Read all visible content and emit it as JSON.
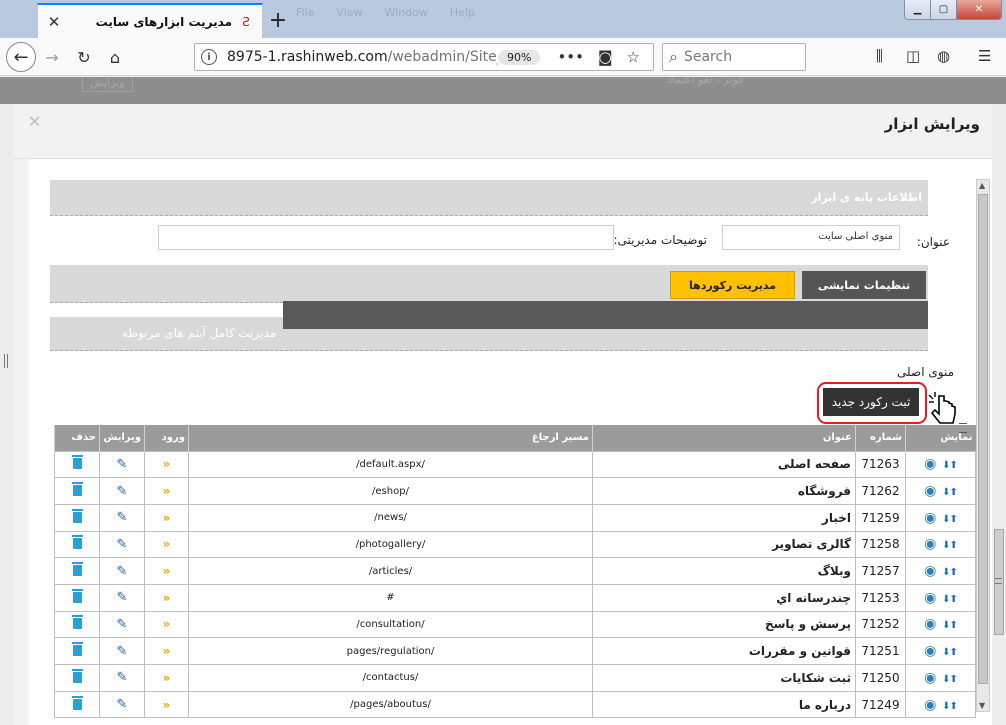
{
  "browser": {
    "tab_title": "مدیریت ابزارهای سایت",
    "tab_favicon": "Ƨ",
    "tab_close": "✕",
    "new_tab": "+",
    "ghost_menu": [
      "File",
      "View",
      "Window",
      "Help"
    ],
    "url_host": "8975-1.rashinweb.com",
    "url_path": "/webadmin/Site_",
    "zoom": "90%",
    "search_placeholder": "Search"
  },
  "ghost_top": {
    "edit": "ویرایش",
    "footer": "فوتر - لغو اعتماد"
  },
  "modal": {
    "title": "ویرایش ابزار",
    "close": "✕"
  },
  "form": {
    "section_title": "اطلاعات پایه ی ابزار",
    "title_label": "عنوان:",
    "title_value": "منوی اصلی سایت",
    "notes_label": "توضیحات مدیریتی:",
    "notes_value": ""
  },
  "tabs": {
    "display": "تنظیمات نمایشی",
    "records": "مدیریت رکوردها"
  },
  "manage_text": "مدیریت کامل آیتم های مربوطه",
  "menu_label": "منوی اصلی",
  "add_button": "ثبت رکورد جدید",
  "table": {
    "headers": {
      "show": "نمایش",
      "id": "شماره",
      "title": "عنوان",
      "path": "مسیر ارجاع",
      "login": "ورود",
      "edit": "ویرایش",
      "delete": "حذف"
    },
    "rows": [
      {
        "id": "71263",
        "title": "صفحه اصلی",
        "path": "/default.aspx/"
      },
      {
        "id": "71262",
        "title": "فروشگاه",
        "path": "/eshop/"
      },
      {
        "id": "71259",
        "title": "اخبار",
        "path": "/news/"
      },
      {
        "id": "71258",
        "title": "گالری تصاویر",
        "path": "/photogallery/"
      },
      {
        "id": "71257",
        "title": "وبلاگ",
        "path": "/articles/"
      },
      {
        "id": "71253",
        "title": "چندرسانه اي",
        "path": "#"
      },
      {
        "id": "71252",
        "title": "پرسش و پاسخ",
        "path": "/consultation/"
      },
      {
        "id": "71251",
        "title": "قوانین و مقررات",
        "path": "/pages/regulation"
      },
      {
        "id": "71250",
        "title": "ثبت شکایات",
        "path": "/contactus/"
      },
      {
        "id": "71249",
        "title": "درباره ما",
        "path": "/pages/aboutus/"
      }
    ]
  },
  "colors": {
    "active_tab": "#ffc000",
    "highlight_ring": "#e02020",
    "icon_blue": "#2a63b0"
  }
}
